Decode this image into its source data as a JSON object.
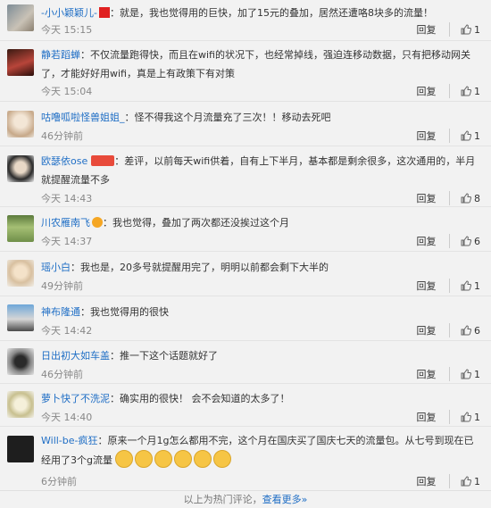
{
  "actions": {
    "reply": "回复"
  },
  "comments": [
    {
      "user": "-小小颖颖儿-",
      "text": "就是，我也觉得用的巨快，加了15元的叠加，居然还遭咯8块多的流量！",
      "time": "今天 15:15",
      "likes": "1"
    },
    {
      "user": "静若蹈蝉",
      "text": "不仅流量跑得快，而且在wifi的状况下，也经常掉线，强迫连移动数据，只有把移动网关了，才能好好用wifi，真是上有政策下有对策",
      "time": "今天 15:04",
      "likes": "1"
    },
    {
      "user": "咕噜呱啦怪兽姐姐_",
      "text": "怪不得我这个月流量充了三次！！移动去死吧",
      "time": "46分钟前",
      "likes": "1"
    },
    {
      "user": "欧瑟依ose",
      "text": "差评，以前每天wifi供着，自有上下半月，基本都是剩余很多，这次通用的，半月就提醒流量不多",
      "time": "今天 14:43",
      "likes": "8"
    },
    {
      "user": "川农雁南飞",
      "text": "我也觉得，叠加了两次都还没挨过这个月",
      "time": "今天 14:37",
      "likes": "6"
    },
    {
      "user": "瑶小白",
      "text": "我也是，20多号就提醒用完了，明明以前都会剩下大半的",
      "time": "49分钟前",
      "likes": "1"
    },
    {
      "user": "神布隆通",
      "text": "我也觉得用的很快",
      "time": "今天 14:42",
      "likes": "6"
    },
    {
      "user": "日出初大如车盖",
      "text": "推一下这个话题就好了",
      "time": "46分钟前",
      "likes": "1"
    },
    {
      "user": "萝卜快了不洗泥",
      "text": "确实用的很快！ 会不会知道的太多了！",
      "time": "今天 14:40",
      "likes": "1"
    },
    {
      "user": "Will-be-疯狂",
      "text": "原来一个月1g怎么都用不完，这个月在国庆买了国庆七天的流量包。从七号到现在已经用了3个g流量",
      "time": "6分钟前",
      "likes": "1"
    }
  ],
  "footer": {
    "prefix": "以上为热门评论，",
    "link": "查看更多»"
  },
  "colors": {
    "link": "#1f6ec5",
    "background": "#f2f2f2"
  }
}
